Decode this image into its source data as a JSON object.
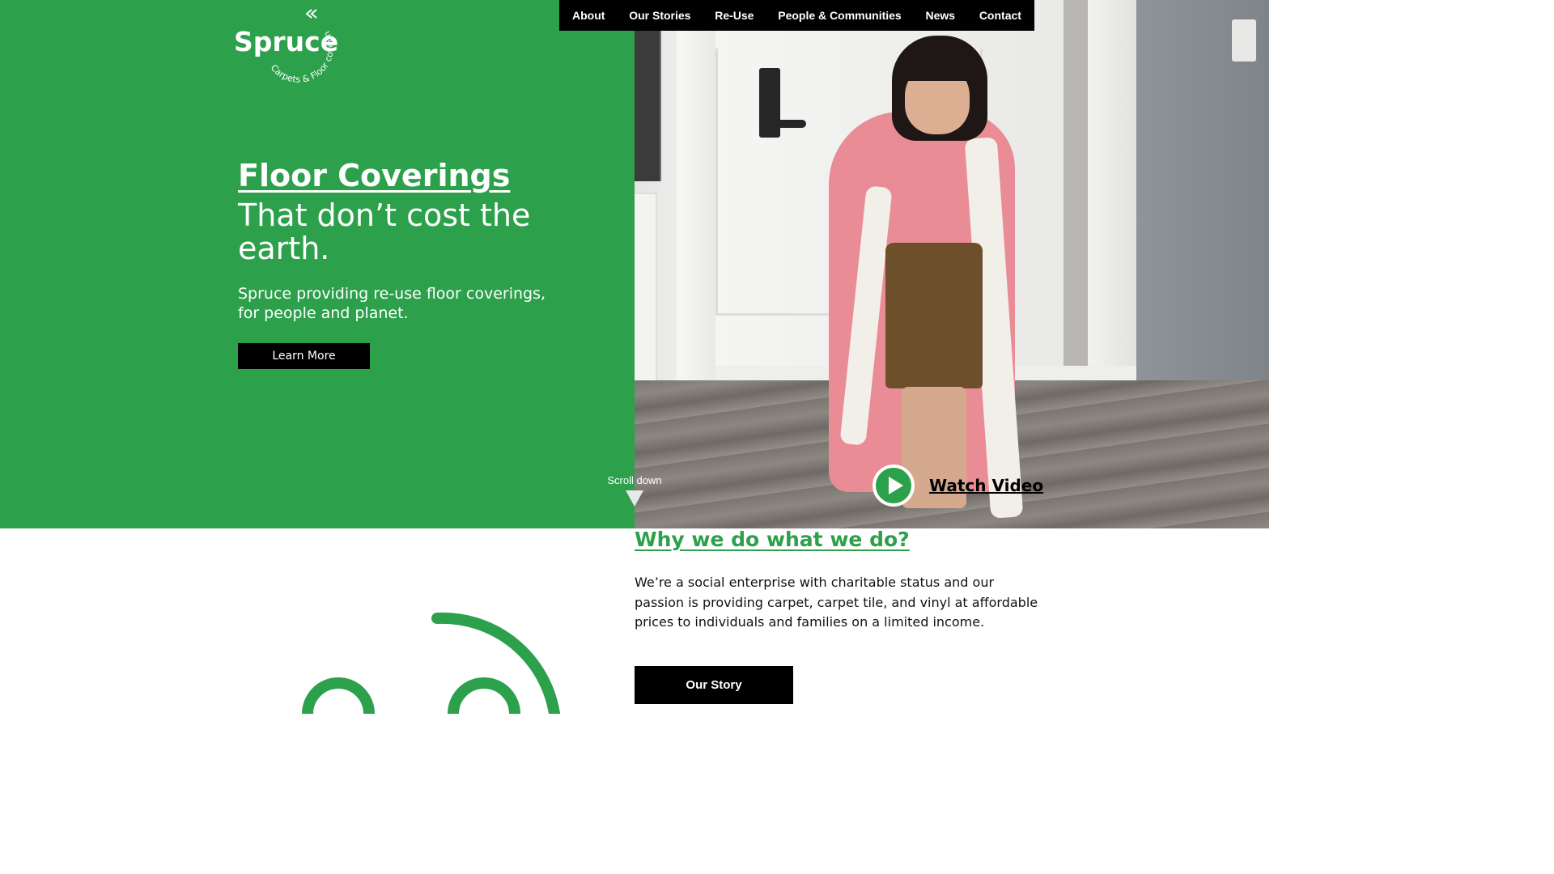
{
  "nav": {
    "items": [
      "About",
      "Our Stories",
      "Re-Use",
      "People & Communities",
      "News",
      "Contact"
    ]
  },
  "logo": {
    "wordmark": "Spruce",
    "ring_text": "Carpets & Floor coverings"
  },
  "hero": {
    "title": "Floor Coverings",
    "subtitle": "That don’t cost the earth.",
    "description": "Spruce providing re-use floor coverings, for people and planet.",
    "cta_label": "Learn More",
    "scroll_label": "Scroll down",
    "watch_label": "Watch Video",
    "icons": [
      "chevron-double-icon",
      "triangle-down-icon",
      "play-icon",
      "smile-icon"
    ]
  },
  "why": {
    "title": "Why we do what we do?",
    "body": "We’re a social enterprise with charitable status and our passion is providing carpet, carpet tile, and vinyl at affordable prices to individuals and families on a limited income.",
    "cta_label": "Our Story"
  },
  "colors": {
    "brand_green": "#2da04c",
    "black": "#000000",
    "white": "#ffffff"
  }
}
